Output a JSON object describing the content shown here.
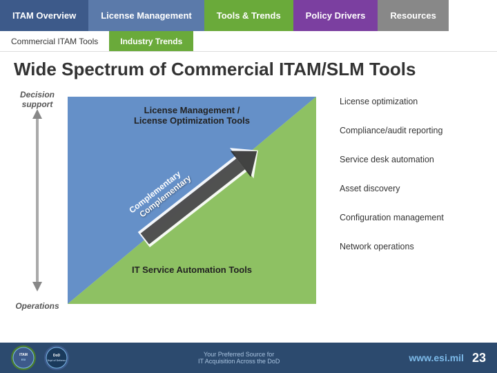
{
  "nav": {
    "items": [
      {
        "label": "ITAM Overview",
        "class": "nav-itam"
      },
      {
        "label": "License Management",
        "class": "nav-license"
      },
      {
        "label": "Tools & Trends",
        "class": "nav-tools"
      },
      {
        "label": "Policy Drivers",
        "class": "nav-policy"
      },
      {
        "label": "Resources",
        "class": "nav-resources"
      }
    ]
  },
  "second_nav": {
    "items": [
      {
        "label": "Commercial ITAM Tools",
        "active": false
      },
      {
        "label": "Industry Trends",
        "active": true
      }
    ]
  },
  "page": {
    "title": "Wide Spectrum of Commercial ITAM/SLM Tools"
  },
  "left_axis": {
    "top_label": "Decision\nsupport",
    "bottom_label": "Operations"
  },
  "diagram": {
    "lm_label_line1": "License Management /",
    "lm_label_line2": "License Optimization Tools",
    "it_label": "IT Service Automation Tools",
    "complementary_label": "Complementary"
  },
  "right_labels": [
    {
      "text": "License optimization"
    },
    {
      "text": "Compliance/audit reporting"
    },
    {
      "text": "Service desk automation"
    },
    {
      "text": "Asset discovery"
    },
    {
      "text": "Configuration management"
    },
    {
      "text": "Network operations"
    }
  ],
  "bottom": {
    "tagline_line1": "Your Preferred Source for",
    "tagline_line2": "IT Acquisition Across the DoD",
    "website": "www.esi.mil",
    "page_number": "23"
  }
}
